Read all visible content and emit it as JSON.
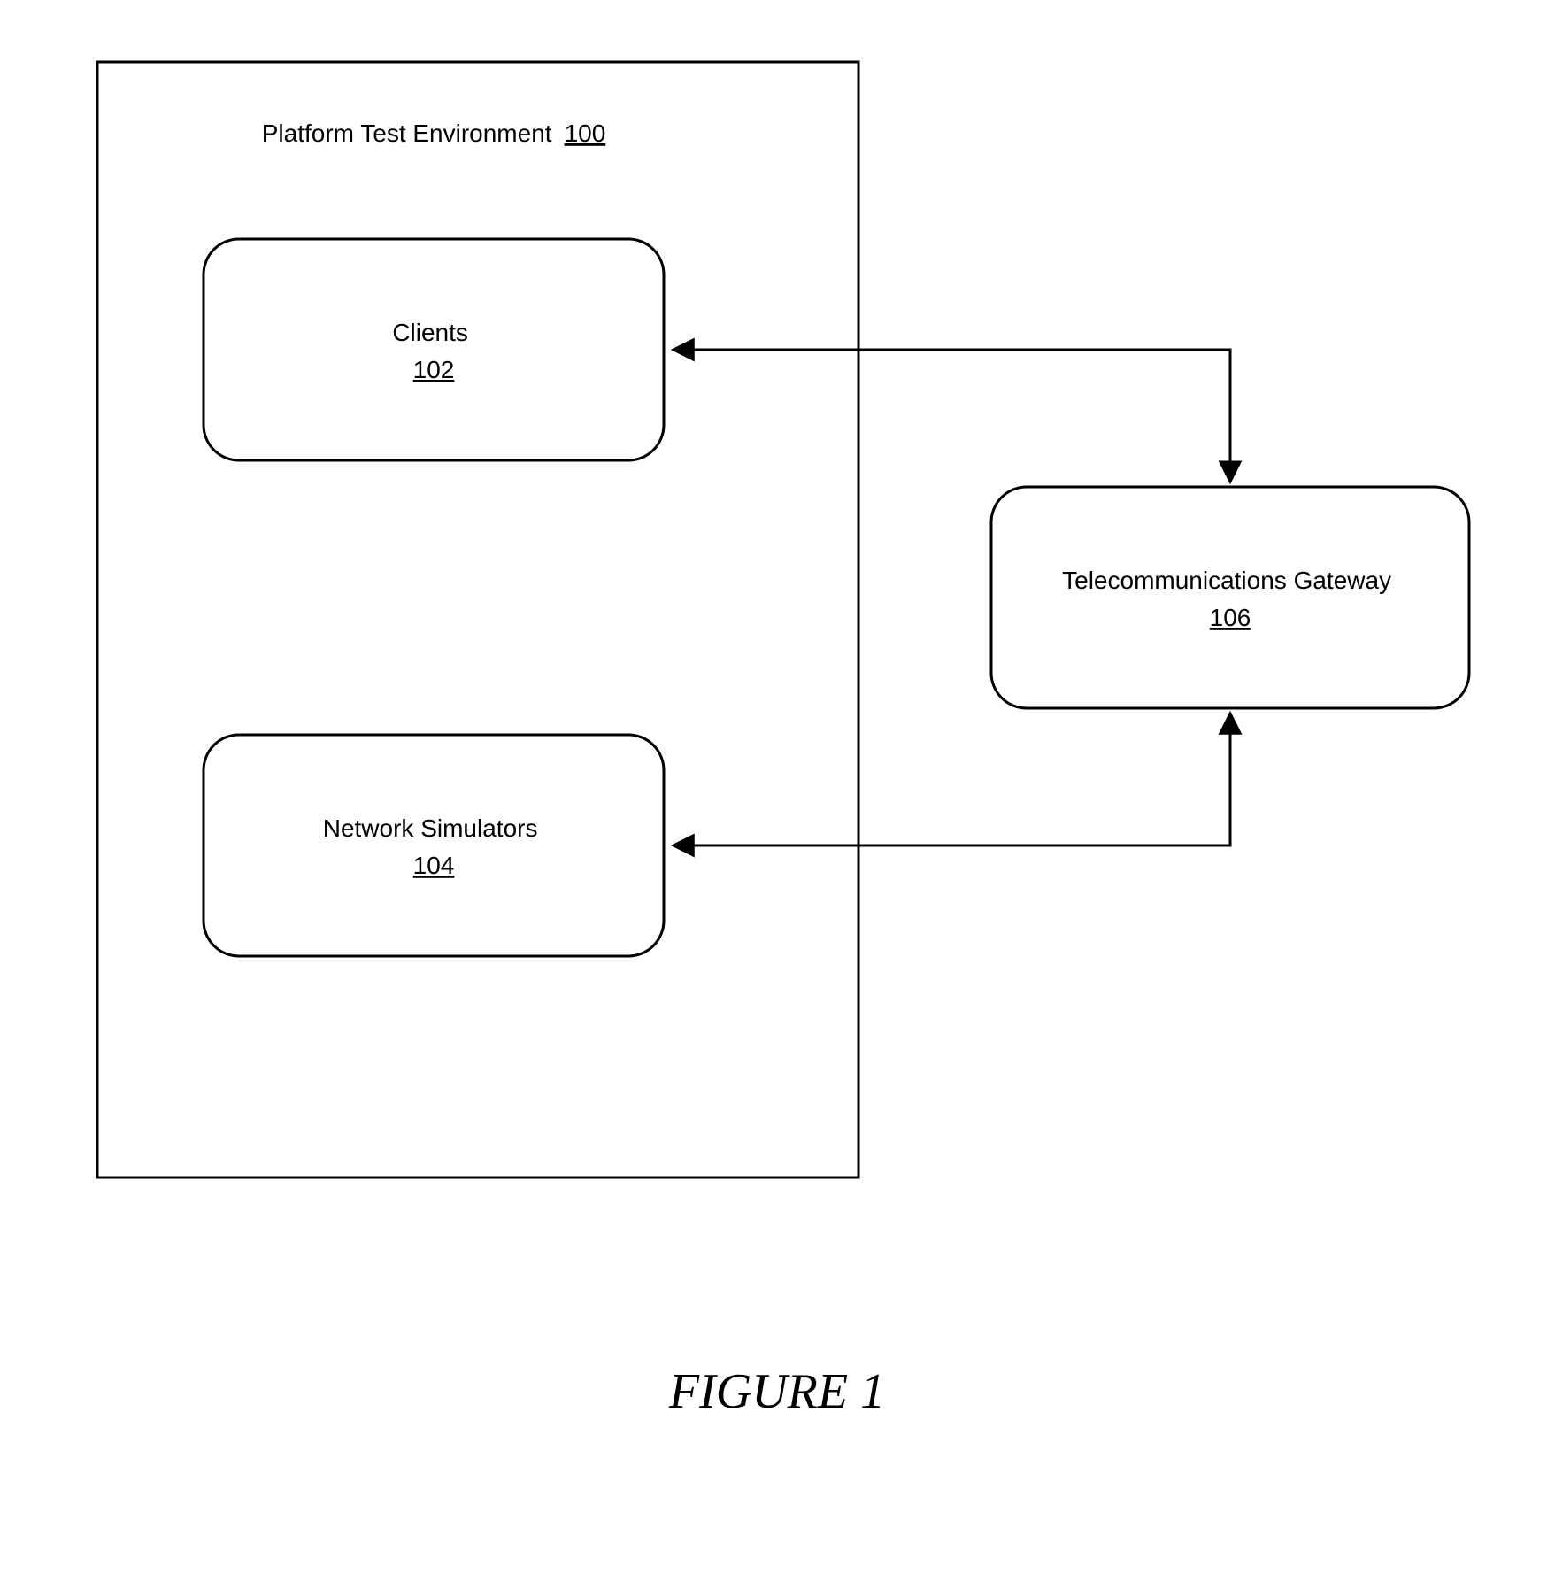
{
  "outer": {
    "label": "Platform Test Environment",
    "ref": "100"
  },
  "clients": {
    "label": "Clients",
    "ref": "102"
  },
  "netsim": {
    "label": "Network Simulators",
    "ref": "104"
  },
  "gateway": {
    "label": "Telecommunications Gateway",
    "ref": "106"
  },
  "caption": "FIGURE 1"
}
